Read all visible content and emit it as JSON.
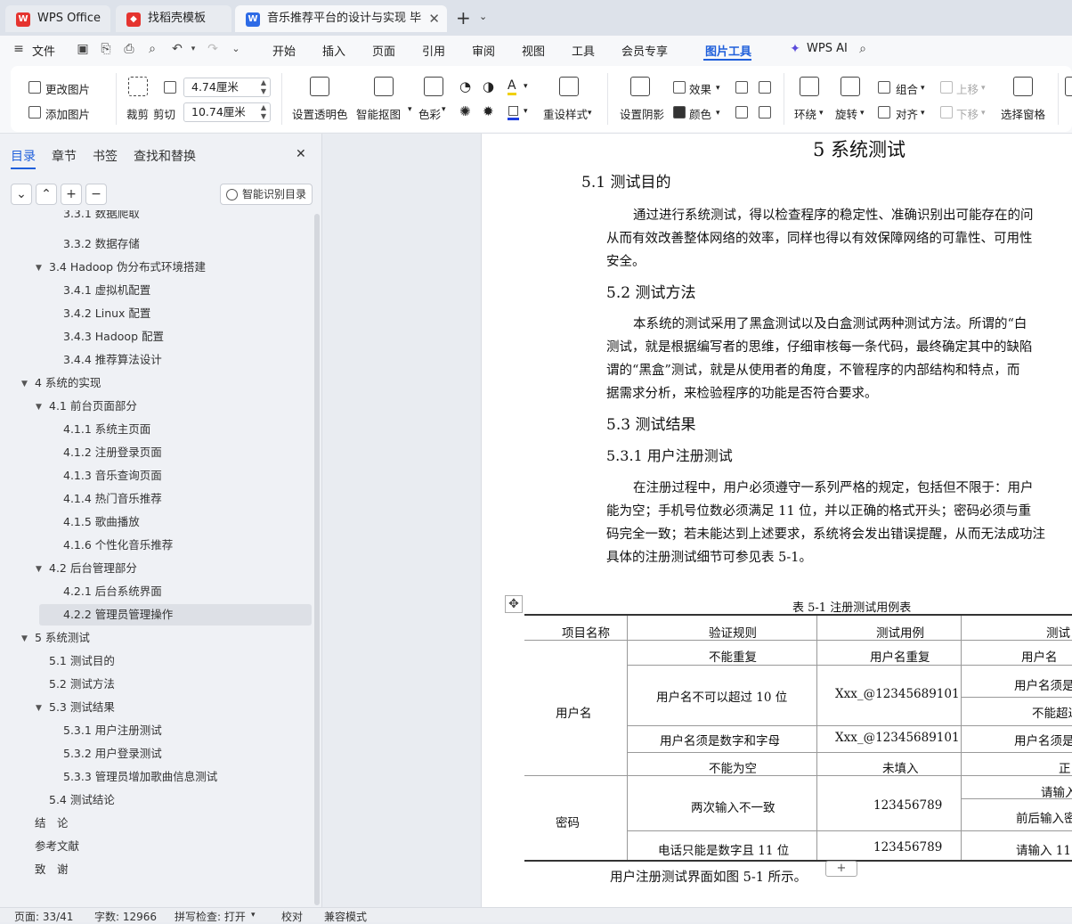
{
  "tabs": {
    "wps": "WPS Office",
    "template": "找稻壳模板",
    "doc": "音乐推荐平台的设计与实现 毕"
  },
  "menu": {
    "file": "文件",
    "start": "开始",
    "insert": "插入",
    "page": "页面",
    "reference": "引用",
    "review": "审阅",
    "view": "视图",
    "tools": "工具",
    "vip": "会员专享",
    "picture_tools": "图片工具",
    "wps_ai": "WPS AI"
  },
  "ribbon": {
    "change_picture": "更改图片",
    "add_picture": "添加图片",
    "crop": "裁剪",
    "clip": "剪切",
    "height_value": "4.74厘米",
    "width_value": "10.74厘米",
    "set_transparent": "设置透明色",
    "smart_cutout": "智能抠图",
    "color": "色彩",
    "reset_style": "重设样式",
    "set_shadow": "设置阴影",
    "effect": "效果",
    "fill_color": "颜色",
    "wrap": "环绕",
    "rotate": "旋转",
    "group": "组合",
    "align": "对齐",
    "move_up": "上移",
    "move_down": "下移",
    "selection_pane": "选择窗格"
  },
  "nav": {
    "tab_toc": "目录",
    "tab_chapter": "章节",
    "tab_bookmark": "书签",
    "tab_find": "查找和替换",
    "close": "✕",
    "smart_toc": "智能识别目录",
    "toc": [
      "3.3.1 数据爬取",
      "3.3.2 数据存储",
      "3.4 Hadoop 伪分布式环境搭建",
      "3.4.1 虚拟机配置",
      "3.4.2 Linux 配置",
      "3.4.3 Hadoop 配置",
      "3.4.4 推荐算法设计",
      "4 系统的实现",
      "4.1 前台页面部分",
      "4.1.1 系统主页面",
      "4.1.2 注册登录页面",
      "4.1.3 音乐查询页面",
      "4.1.4 热门音乐推荐",
      "4.1.5 歌曲播放",
      "4.1.6 个性化音乐推荐",
      "4.2 后台管理部分",
      "4.2.1 后台系统界面",
      "4.2.2 管理员管理操作",
      "5 系统测试",
      "5.1 测试目的",
      "5.2 测试方法",
      "5.3 测试结果",
      "5.3.1 用户注册测试",
      "5.3.2 用户登录测试",
      "5.3.3 管理员增加歌曲信息测试",
      "5.4 测试结论",
      "结　论",
      "参考文献",
      "致　谢"
    ]
  },
  "doc": {
    "h1": "5 系统测试",
    "h_51": "5.1  测试目的",
    "p1_l1": "通过进行系统测试，得以检查程序的稳定性、准确识别出可能存在的问",
    "p1_l2": "从而有效改善整体网络的效率，同样也得以有效保障网络的可靠性、可用性",
    "p1_l3": "安全。",
    "h_52": "5.2 测试方法",
    "p2_l1": "本系统的测试采用了黑盒测试以及白盒测试两种测试方法。所谓的“白",
    "p2_l2": "测试，就是根据编写者的思维，仔细审核每一条代码，最终确定其中的缺陷",
    "p2_l3": "谓的“黑盒”测试，就是从使用者的角度，不管程序的内部结构和特点，而",
    "p2_l4": "据需求分析，来检验程序的功能是否符合要求。",
    "h_53": "5.3 测试结果",
    "h_531": "5.3.1 用户注册测试",
    "p3_l1": "在注册过程中，用户必须遵守一系列严格的规定，包括但不限于：用户",
    "p3_l2": "能为空；手机号位数必须满足 11 位，并以正确的格式开头；密码必须与重",
    "p3_l3": "码完全一致；若未能达到上述要求，系统将会发出错误提醒，从而无法成功注",
    "p3_l4": "具体的注册测试细节可参见表 5-1。",
    "table_caption": "表 5-1 注册测试用例表",
    "table": {
      "headers": [
        "项目名称",
        "验证规则",
        "测试用例",
        "测试"
      ],
      "group1": "用户名",
      "group2": "密码",
      "r1": [
        "不能重复",
        "用户名重复",
        "用户名"
      ],
      "r2": [
        "用户名不可以超过 10 位",
        "Xxx_@12345689101",
        "用户名须是",
        "不能超过"
      ],
      "r3": [
        "用户名须是数字和字母",
        "Xxx_@12345689101",
        "用户名须是"
      ],
      "r4": [
        "不能为空",
        "未填入",
        "正"
      ],
      "r5": [
        "两次输入不一致",
        "123456789",
        "请输入",
        "前后输入密"
      ],
      "r6": [
        "电话只能是数字且 11 位",
        "123456789",
        "请输入 11"
      ]
    },
    "after_table": "用户注册测试界面如图 5-1 所示。"
  },
  "status": {
    "page": "页面: 33/41",
    "words": "字数: 12966",
    "spell": "拼写检查: 打开",
    "proof": "校对",
    "compat": "兼容模式"
  }
}
